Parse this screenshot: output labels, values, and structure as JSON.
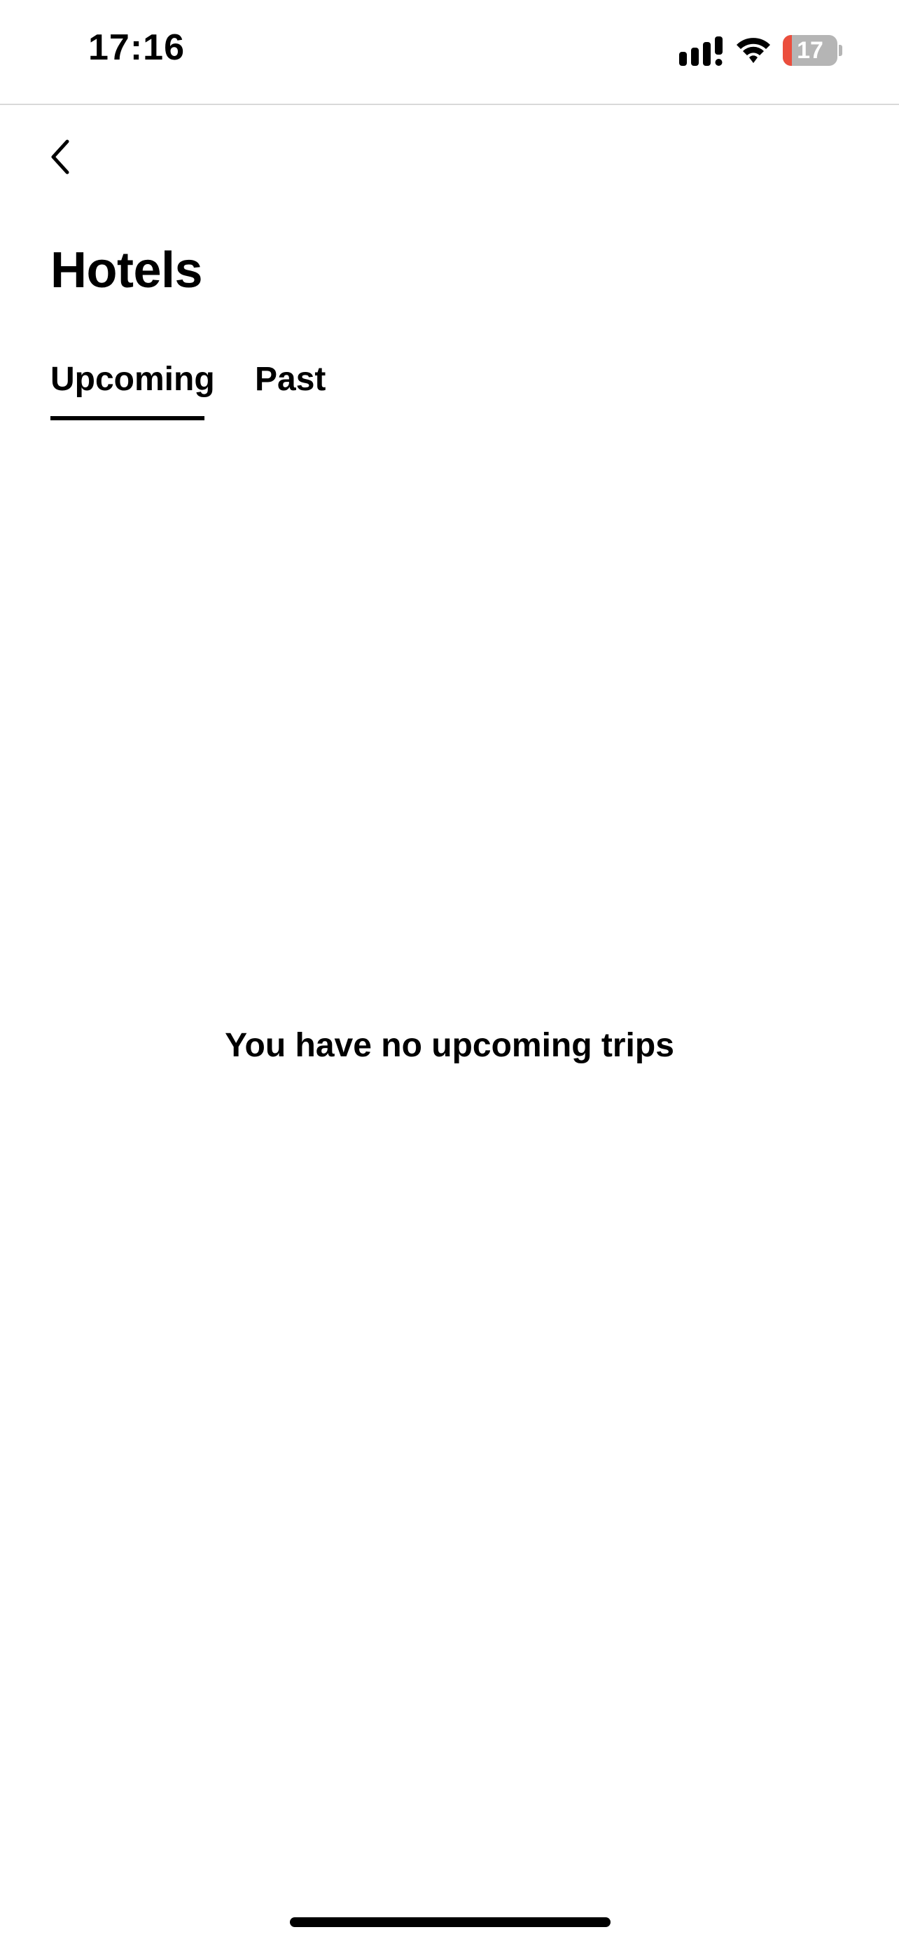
{
  "status_bar": {
    "time": "17:16",
    "battery_level": "17",
    "battery_fraction": 0.17,
    "icons": [
      "signal-icon",
      "wifi-icon",
      "battery-icon"
    ]
  },
  "nav": {
    "back_icon": "chevron-left-icon"
  },
  "page": {
    "title": "Hotels"
  },
  "tabs": [
    {
      "label": "Upcoming",
      "selected": true
    },
    {
      "label": "Past",
      "selected": false
    }
  ],
  "empty_state": {
    "message": "You have no upcoming trips"
  },
  "colors": {
    "text": "#000000",
    "background": "#ffffff",
    "battery_low": "#eb4e3d",
    "battery_body": "#b5b5b5"
  }
}
